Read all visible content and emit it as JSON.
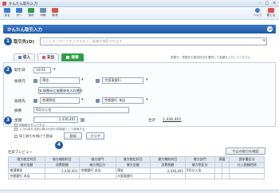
{
  "window": {
    "title": "かんたん取引入力",
    "min": "–",
    "max": "□",
    "close": "×"
  },
  "toolbar": {
    "left": [
      {
        "label": "戻る",
        "color": "#3b7dd8"
      },
      {
        "label": "次へ",
        "color": "#3b7dd8"
      },
      {
        "label": "保存",
        "color": "#2e9e47"
      },
      {
        "label": "印刷",
        "color": "#6c8fb8"
      },
      {
        "label": "取消",
        "color": "#d9534f"
      }
    ],
    "right": [
      {
        "label": "ヘルプ",
        "color": "#3b7dd8"
      },
      {
        "label": "閉じる",
        "color": "#d9534f"
      }
    ]
  },
  "header": {
    "title": "かんたん取引入力"
  },
  "search": {
    "label": "取引先(D)",
    "placeholder": "ここにキーワードを入力すると、候補が検索されます"
  },
  "tabs": [
    {
      "label": "収入",
      "color": "#3b7dd8"
    },
    {
      "label": "支出",
      "color": "#d9534f"
    },
    {
      "label": "振替",
      "color": "#ffffff"
    }
  ],
  "tab_note": "振替元・振替先の勘定科目を選択して金額を入力してください",
  "form": {
    "date_label": "取引日",
    "date_value": "10/31",
    "from_label": "振替元",
    "from_account": "預金",
    "from_sub": "大阪東銀行",
    "swap_label": "振替元と振替先を入れ替え",
    "to_label": "振替先",
    "to_account": "普通預金",
    "to_sub": "京都銀行 本店",
    "memo_label": "摘要",
    "memo_value": "9月分入金",
    "amount_label": "金額",
    "amount_value": "2,436,401",
    "total_label": "合計",
    "total_value": "2,436,401",
    "check1": "相殺取引を入力する",
    "check2": "入力内容を次回以降の仕訳の初期値として使用する",
    "check3": "同じ取引を続けて登録"
  },
  "buttons": {
    "register": "登録",
    "clear": "クリア",
    "list": "今日の取引を確認"
  },
  "preview": {
    "title": "仕訳プレビュー",
    "headers1": [
      "借方勘定科目",
      "借方補助科目",
      "借方部門",
      "貸方勘定科目",
      "貸方補助科目",
      "貸方部門",
      "摘要",
      "",
      "請求書区分"
    ],
    "headers2": [
      "借方金額",
      "消費税額",
      "借方税区分",
      "貸方金額",
      "消費税額",
      "貸方税区分",
      "",
      "",
      "仕入税額控除"
    ],
    "row1": [
      "普通預金",
      "2,436,401",
      "京都銀行 本店",
      "預金",
      "2,436,401",
      "9月分入金",
      "",
      "",
      ""
    ],
    "row2": [
      "京都銀行 本店",
      "",
      "",
      "大阪東銀行",
      "",
      "",
      "",
      "",
      ""
    ]
  }
}
